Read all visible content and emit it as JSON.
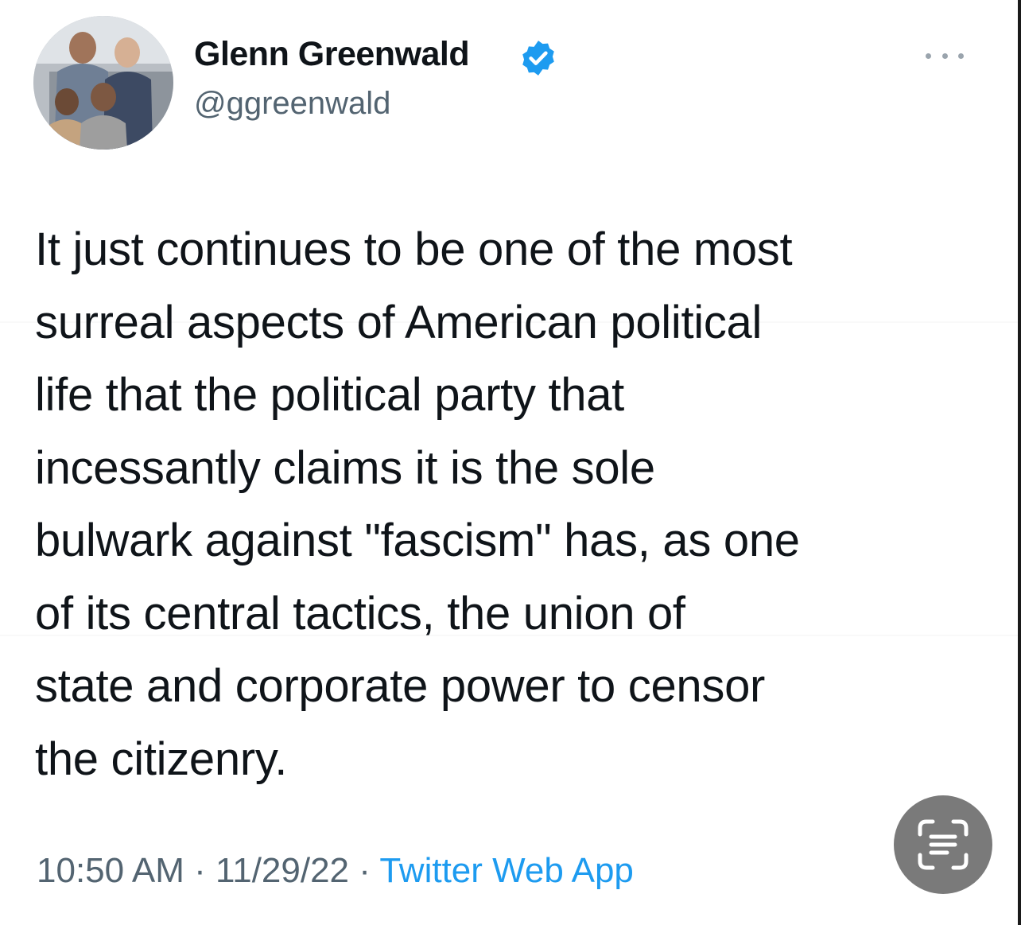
{
  "tweet": {
    "author": {
      "display_name": "Glenn Greenwald",
      "handle": "@ggreenwald",
      "verified": true,
      "avatar_icon": "profile-photo"
    },
    "more_icon": "more-horizontal-icon",
    "text_lines": [
      "It just continues to be one of the most",
      "surreal aspects of American political",
      "life that the political party that",
      "incessantly claims it is the sole",
      "bulwark against \"fascism\" has, as one",
      "of its central tactics, the union of",
      "state and corporate power to censor",
      "the citizenry."
    ],
    "time": "10:50 AM",
    "separator": " · ",
    "date": "11/29/22",
    "source": "Twitter Web App"
  },
  "overlay": {
    "scan_button_icon": "live-text-scan-icon"
  },
  "colors": {
    "text_primary": "#0f1419",
    "text_secondary": "#536471",
    "verified_blue": "#1d9bf0",
    "link_blue": "#1d9bf0",
    "scan_button_bg": "#7a7a7a"
  }
}
